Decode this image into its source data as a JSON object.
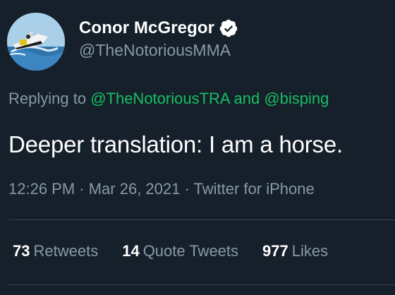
{
  "author": {
    "display_name": "Conor McGregor",
    "handle": "@TheNotoriousMMA",
    "verified": true,
    "verified_icon": "verified-badge-icon"
  },
  "reply": {
    "prefix": "Replying to ",
    "mention1": "@TheNotoriousTRA",
    "joiner": " and ",
    "mention2": "@bisping"
  },
  "tweet": {
    "text": "Deeper translation: I am a horse."
  },
  "meta": {
    "time": "12:26 PM",
    "sep1": " · ",
    "date": "Mar 26, 2021",
    "sep2": " · ",
    "source": "Twitter for iPhone"
  },
  "stats": {
    "retweets_count": "73",
    "retweets_label": "Retweets",
    "quotes_count": "14",
    "quotes_label": "Quote Tweets",
    "likes_count": "977",
    "likes_label": "Likes"
  },
  "colors": {
    "background": "#15202b",
    "secondary_text": "#8899a6",
    "mention_green": "#17bf63",
    "divider": "#38444d"
  }
}
